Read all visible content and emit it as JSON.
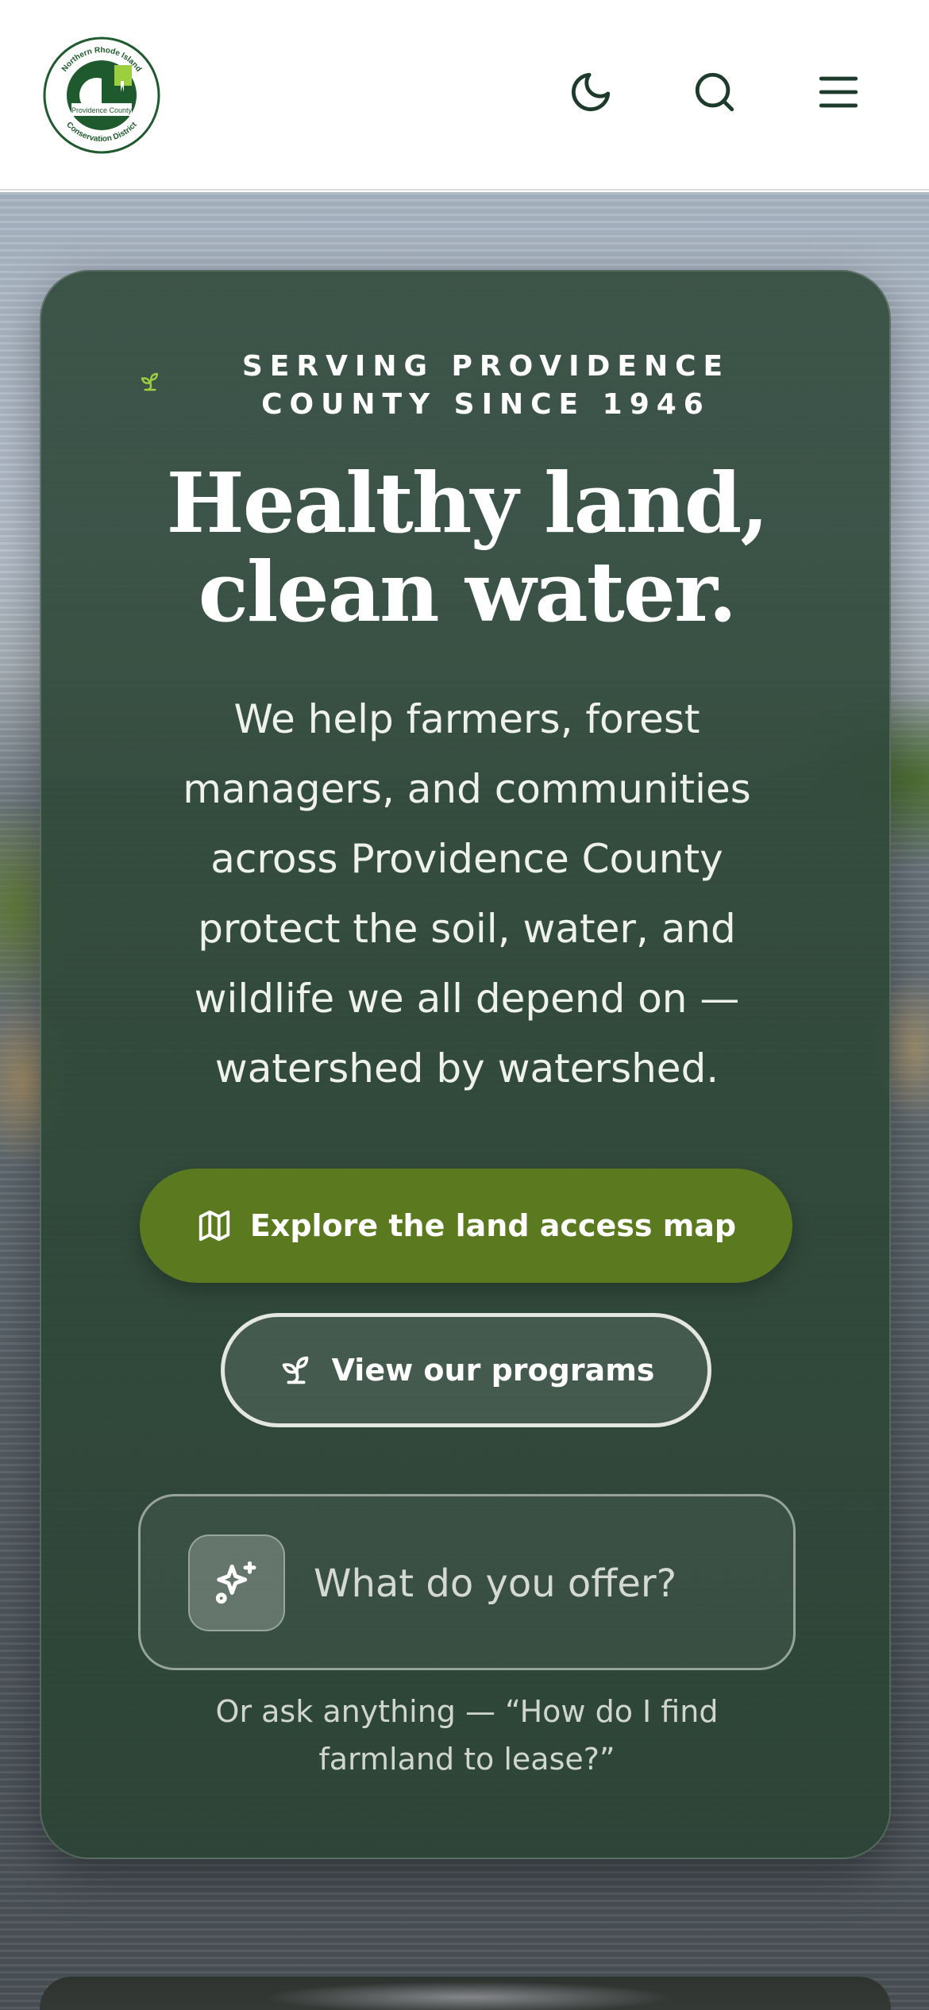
{
  "header": {
    "logo": {
      "name": "northern-rhode-island-conservation-district-logo",
      "ring_top_text": "Northern Rhode Island",
      "ring_bottom_text": "Conservation District",
      "center_text": "Providence County"
    },
    "icons": {
      "theme": "moon-icon",
      "search": "search-icon",
      "menu": "menu-icon"
    }
  },
  "hero": {
    "eyebrow": "SERVING PROVIDENCE COUNTY SINCE 1946",
    "headline_line1": "Healthy land,",
    "headline_line2": "clean water.",
    "intro": "We help farmers, forest managers, and communities across Providence County protect the soil, water, and wildlife we all depend on — watershed by watershed.",
    "primary_cta": {
      "label": "Explore the land access map",
      "icon": "map-icon"
    },
    "secondary_cta": {
      "label": "View our programs",
      "icon": "sprout-icon"
    },
    "ask": {
      "placeholder": "What do you offer?",
      "icon": "sparkles-icon",
      "hint": "Or ask anything — “How do I find farmland to lease?”"
    }
  },
  "colors": {
    "brand_green": "#1f5a2e",
    "cta_green": "#5b7a1f",
    "card_bg": "#2e4838",
    "accent_sprout": "#9bcf3f"
  }
}
